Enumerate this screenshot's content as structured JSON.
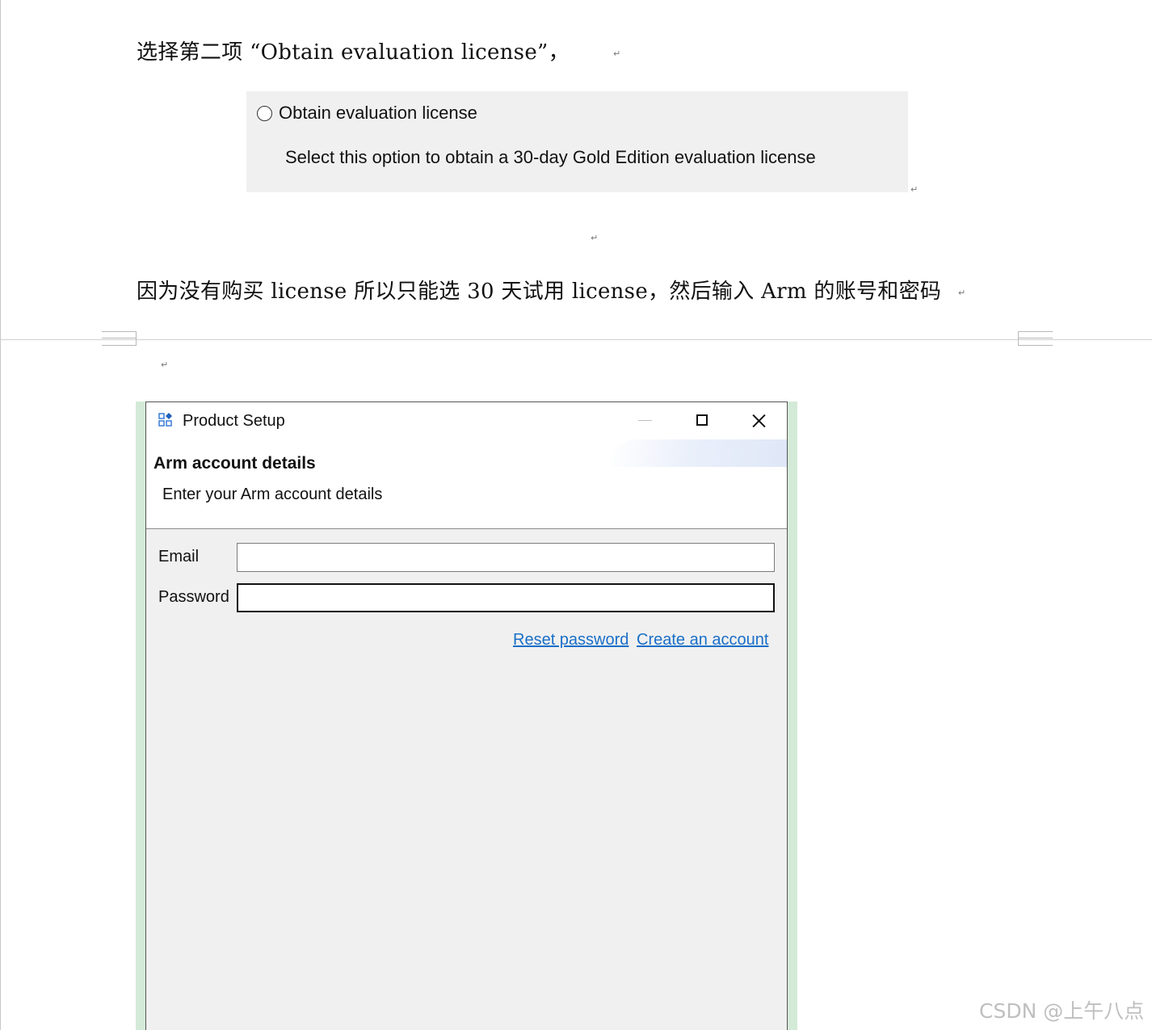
{
  "document": {
    "para1": "选择第二项 “Obtain evaluation license”，",
    "para2": "因为没有购买 license 所以只能选 30 天试用 license，然后输入 Arm 的账号和密码",
    "para_mark": "↵"
  },
  "license_option": {
    "label": "Obtain evaluation license",
    "description": "Select this option to obtain a 30-day Gold Edition evaluation license"
  },
  "dialog": {
    "window_title": "Product Setup",
    "heading": "Arm account details",
    "subheading": "Enter your Arm account details",
    "email_label": "Email",
    "email_value": "",
    "password_label": "Password",
    "password_value": "",
    "reset_link": "Reset password",
    "create_link": "Create an account"
  },
  "watermark": "CSDN @上午八点",
  "colors": {
    "link": "#1a6fc8",
    "dialog_bg": "#f0f0f0",
    "frame_accent": "#d4ead8"
  },
  "icons": [
    "product-setup-icon",
    "minimize-icon",
    "maximize-icon",
    "close-icon",
    "radio-unselected-icon"
  ]
}
